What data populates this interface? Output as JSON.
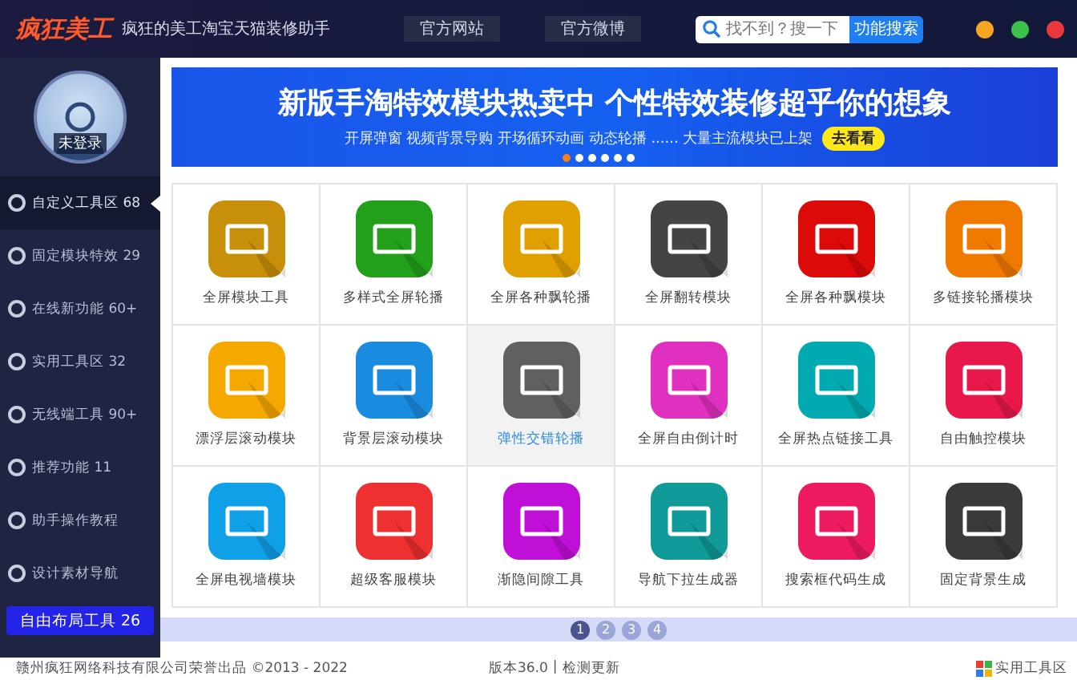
{
  "topbar": {
    "logo": "疯狂美工",
    "tagline": "疯狂的美工淘宝天猫装修助手",
    "nav": [
      "官方网站",
      "官方微博"
    ],
    "search": {
      "placeholder": "找不到？搜一下",
      "button": "功能搜索"
    },
    "window_controls": [
      {
        "color": "#f5a623"
      },
      {
        "color": "#3cc24a"
      },
      {
        "color": "#e8383d"
      }
    ]
  },
  "sidebar": {
    "user": "未登录",
    "items": [
      {
        "kind": "item",
        "label": "自定义工具区 68",
        "selected": true
      },
      {
        "kind": "item",
        "label": "固定模块特效 29",
        "selected": false
      },
      {
        "kind": "item",
        "label": "在线新功能 60+",
        "selected": false
      },
      {
        "kind": "item",
        "label": "实用工具区 32",
        "selected": false
      },
      {
        "kind": "item",
        "label": "无线端工具 90+",
        "selected": false
      },
      {
        "kind": "item",
        "label": "推荐功能 11",
        "selected": false
      },
      {
        "kind": "item",
        "label": "助手操作教程",
        "selected": false
      },
      {
        "kind": "item",
        "label": "设计素材导航",
        "selected": false
      },
      {
        "kind": "button",
        "label": "自由布局工具 26",
        "selected": false
      }
    ]
  },
  "banner": {
    "title": "新版手淘特效模块热卖中 个性特效装修超乎你的想象",
    "subtitle": "开屏弹窗 视频背景导购 开场循环动画 动态轮播 ...... 大量主流模块已上架",
    "button": "去看看",
    "dots": [
      {
        "selected": true
      },
      {
        "selected": false
      },
      {
        "selected": false
      },
      {
        "selected": false
      },
      {
        "selected": false
      },
      {
        "selected": false
      }
    ]
  },
  "tiles": [
    {
      "label": "全屏模块工具",
      "color": "#c8900a",
      "selected": false
    },
    {
      "label": "多样式全屏轮播",
      "color": "#22a01a",
      "selected": false
    },
    {
      "label": "全屏各种飘轮播",
      "color": "#e0a000",
      "selected": false
    },
    {
      "label": "全屏翻转模块",
      "color": "#444444",
      "selected": false
    },
    {
      "label": "全屏各种飘模块",
      "color": "#dd0a0a",
      "selected": false
    },
    {
      "label": "多链接轮播模块",
      "color": "#f07a00",
      "selected": false
    },
    {
      "label": "漂浮层滚动模块",
      "color": "#f5a800",
      "selected": false
    },
    {
      "label": "背景层滚动模块",
      "color": "#1a8ce0",
      "selected": false
    },
    {
      "label": "弹性交错轮播",
      "color": "#606060",
      "selected": true
    },
    {
      "label": "全屏自由倒计时",
      "color": "#e030c0",
      "selected": false
    },
    {
      "label": "全屏热点链接工具",
      "color": "#00aab0",
      "selected": false
    },
    {
      "label": "自由触控模块",
      "color": "#e8184a",
      "selected": false
    },
    {
      "label": "全屏电视墙模块",
      "color": "#10a0e8",
      "selected": false
    },
    {
      "label": "超级客服模块",
      "color": "#ee3030",
      "selected": false
    },
    {
      "label": "渐隐间隙工具",
      "color": "#c010d8",
      "selected": false
    },
    {
      "label": "导航下拉生成器",
      "color": "#109a98",
      "selected": false
    },
    {
      "label": "搜索框代码生成",
      "color": "#ee1a60",
      "selected": false
    },
    {
      "label": "固定背景生成",
      "color": "#3a3a3a",
      "selected": false
    }
  ],
  "pages": [
    {
      "label": "1",
      "selected": true
    },
    {
      "label": "2",
      "selected": false
    },
    {
      "label": "3",
      "selected": false
    },
    {
      "label": "4",
      "selected": false
    }
  ],
  "footer": {
    "copyright": "赣州疯狂网络科技有限公司荣誉出品 ©2013 - 2022",
    "version": "版本36.0",
    "separator": "|",
    "update_link": "检测更新",
    "tools_link": "实用工具区"
  }
}
